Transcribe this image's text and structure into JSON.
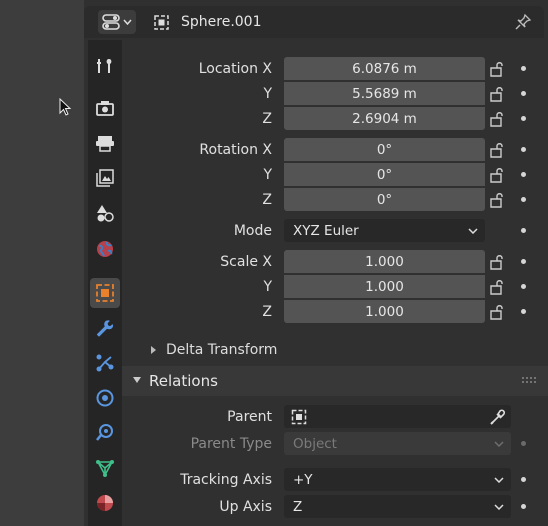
{
  "header": {
    "object_name": "Sphere.001"
  },
  "transform": {
    "location": {
      "label_x": "Location X",
      "label_y": "Y",
      "label_z": "Z",
      "x": "6.0876 m",
      "y": "5.5689 m",
      "z": "2.6904 m"
    },
    "rotation": {
      "label_x": "Rotation X",
      "label_y": "Y",
      "label_z": "Z",
      "x": "0°",
      "y": "0°",
      "z": "0°"
    },
    "mode": {
      "label": "Mode",
      "value": "XYZ Euler"
    },
    "scale": {
      "label_x": "Scale X",
      "label_y": "Y",
      "label_z": "Z",
      "x": "1.000",
      "y": "1.000",
      "z": "1.000"
    }
  },
  "delta_transform": {
    "label": "Delta Transform"
  },
  "relations": {
    "title": "Relations",
    "parent_label": "Parent",
    "parent_type_label": "Parent Type",
    "parent_type_value": "Object",
    "tracking_axis_label": "Tracking Axis",
    "tracking_axis_value": "+Y",
    "up_axis_label": "Up Axis",
    "up_axis_value": "Z"
  },
  "colors": {
    "accent_orange": "#e8802c",
    "field_bg": "#545454",
    "panel_bg": "#303030"
  }
}
